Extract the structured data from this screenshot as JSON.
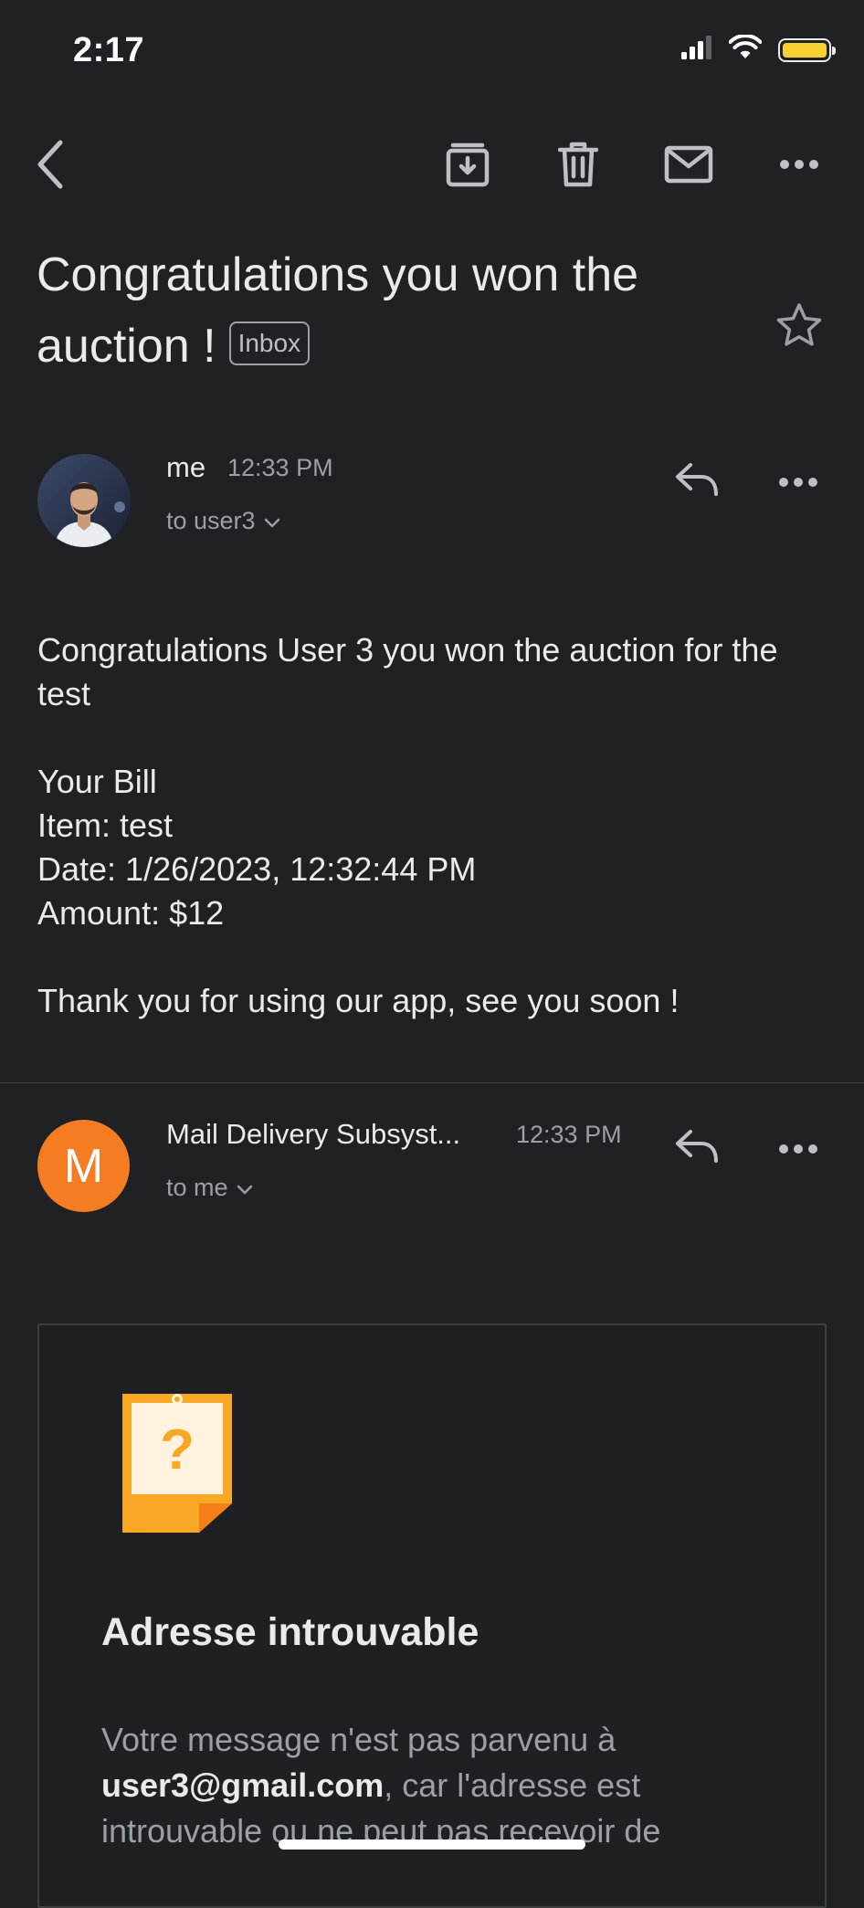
{
  "status_bar": {
    "time": "2:17",
    "signal": "signal-icon",
    "wifi": "wifi-icon",
    "battery": "battery-icon",
    "battery_color": "#f6d12f"
  },
  "toolbar": {
    "back": "back-arrow-icon",
    "archive": "archive-icon",
    "delete": "trash-icon",
    "mark_unread": "mail-icon",
    "more": "more-horizontal-icon"
  },
  "thread": {
    "subject": "Congratulations you won the auction !",
    "label": "Inbox",
    "star": "star-icon"
  },
  "messages": [
    {
      "sender": "me",
      "time": "12:33 PM",
      "recipient": "to user3",
      "body": {
        "line1": "Congratulations User 3 you won the auction for the test",
        "bill_heading": "Your Bill",
        "item": "Item: test",
        "date": "Date: 1/26/2023, 12:32:44 PM",
        "amount": "Amount: $12",
        "closing": "Thank you for using our app, see you soon !"
      }
    },
    {
      "sender": "Mail Delivery Subsyst...",
      "avatar_letter": "M",
      "avatar_color": "#f57c22",
      "time": "12:33 PM",
      "recipient": "to me",
      "bounce": {
        "title": "Adresse introuvable",
        "text_before": "Votre message n'est pas parvenu à ",
        "email": "user3@gmail.com",
        "text_after": ", car l'adresse est introuvable ou ne peut pas recevoir de"
      }
    }
  ]
}
